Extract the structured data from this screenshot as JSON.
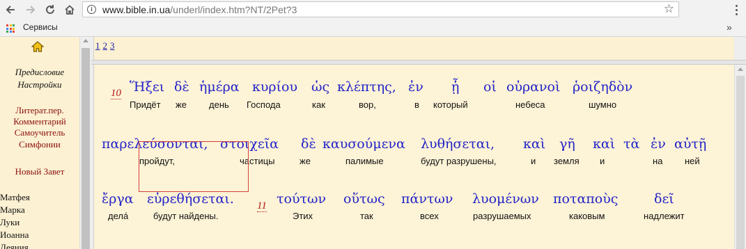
{
  "browser": {
    "url_host": "www.bible.in.ua",
    "url_path": "/underl/index.htm?NT/2Pet?3",
    "bookmarks_label": "Сервисы"
  },
  "left_menu": {
    "preface": "Предисловие",
    "settings": "Настройки",
    "literature": "Литерат.пер.",
    "commentary": "Комментарий",
    "tutorial": "Самоучитель",
    "symphonies": "Симфонии",
    "new_testament": "Новый Завет",
    "books": [
      "Матфея",
      "Марка",
      "Луки",
      "Иоанна",
      "Деяния"
    ]
  },
  "chapters": [
    "1",
    "2",
    "3"
  ],
  "verse_numbers": {
    "v10": "10",
    "v11": "11"
  },
  "line1": {
    "greek": [
      "Ἥξει",
      "δὲ",
      "ἡμέρα",
      "κυρίου",
      "ὡς",
      "κλέπτης,",
      "ἐν",
      "ᾗ",
      "οἱ",
      "οὐρανοὶ",
      "ῥοιζηδὸν"
    ],
    "russian": [
      "Придёт",
      "же",
      "день",
      "Господа",
      "как",
      "вор,",
      "в",
      "который",
      "небеса",
      "шумно"
    ]
  },
  "line2": {
    "greek": [
      "παρελεύσονται,",
      "στοιχεῖα",
      "δὲ",
      "καυσούμενα",
      "λυθήσεται,",
      "καὶ",
      "γῆ",
      "καὶ",
      "τὰ",
      "ἐν",
      "αὐτῇ"
    ],
    "russian": [
      "пройдут,",
      "частицы",
      "же",
      "палимые",
      "будут разрушены,",
      "и",
      "земля",
      "и",
      "на",
      "ней"
    ]
  },
  "line3": {
    "greek": [
      "ἔργα",
      "εὑρεθήσεται.",
      "τούτων",
      "οὕτως",
      "πάντων",
      "λυομένων",
      "ποταποὺς",
      "δεῖ"
    ],
    "russian": [
      "делá",
      "будут найдены.",
      "Этих",
      "так",
      "всех",
      "разрушаемых",
      "каковым",
      "надлежит"
    ]
  }
}
